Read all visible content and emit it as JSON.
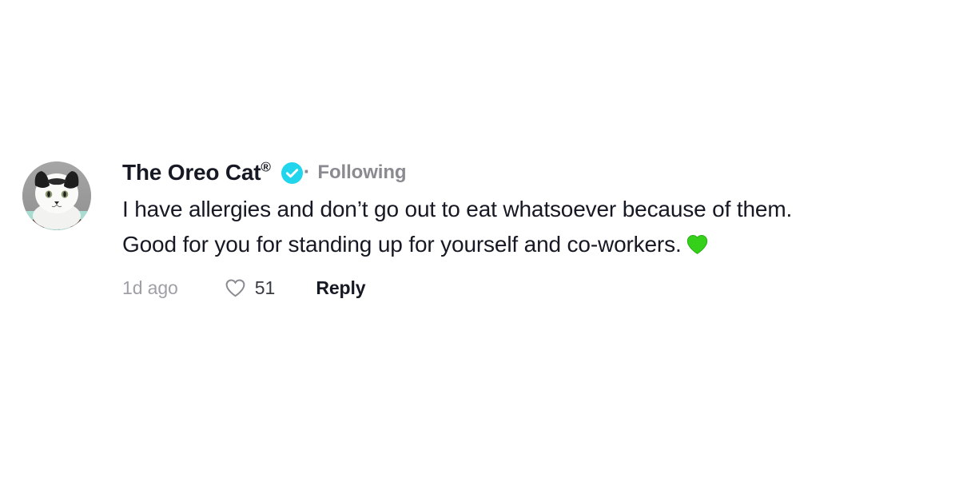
{
  "page": {
    "background_color": "#ffffff",
    "platform_style": "tiktok-comment"
  },
  "comment": {
    "avatar": {
      "alt": "cat-profile-photo",
      "description": "black and white cat wearing teal collar",
      "background_color": "#9a9a9a"
    },
    "author": {
      "display_name": "The Oreo Cat",
      "trademark_symbol": "®",
      "verified": true,
      "verified_badge_color": "#20D5EC",
      "separator": "·",
      "follow_status": "Following",
      "follow_status_color": "#8a8b91"
    },
    "text": {
      "line1": "I have allergies and don’t go out to eat whatsoever because of them.",
      "line2": "Good for you for standing up for yourself and co-workers.",
      "emoji": "💚",
      "emoji_name": "green-heart",
      "emoji_color": "#35D11A",
      "color": "#161823"
    },
    "meta": {
      "timestamp": "1d ago",
      "timestamp_color": "#9ea0a5",
      "like_icon": "heart-outline-icon",
      "like_count": "51",
      "reply_label": "Reply"
    }
  }
}
